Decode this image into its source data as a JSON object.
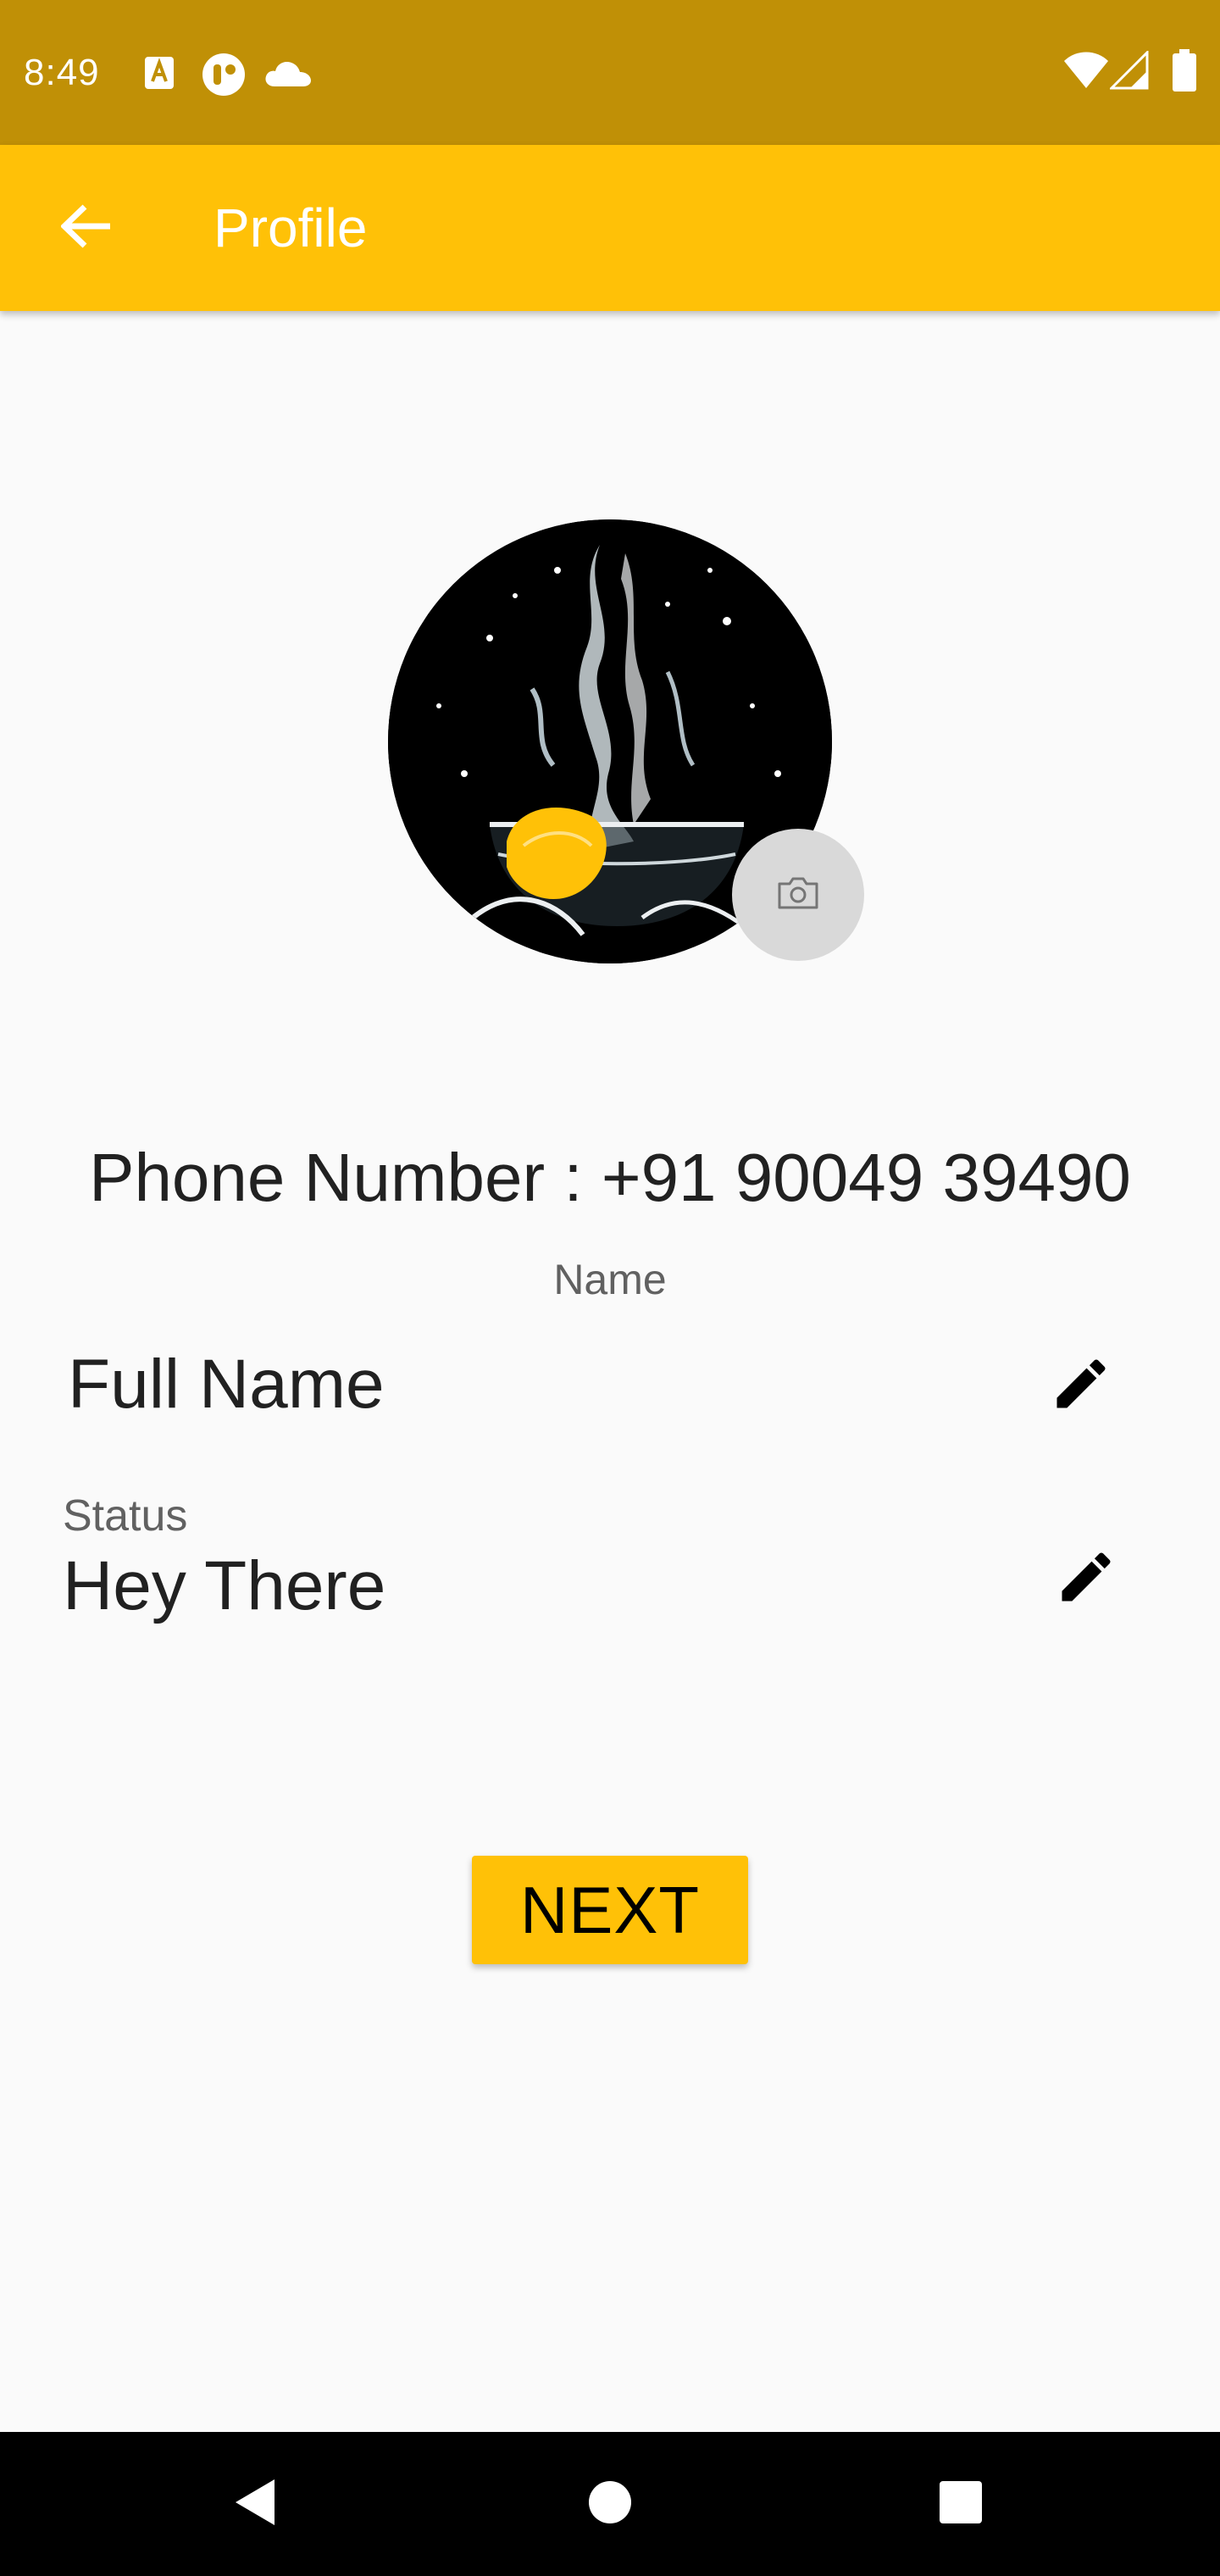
{
  "status_bar": {
    "time": "8:49",
    "icons": [
      "keyboard-a-icon",
      "app-notification-icon",
      "cloud-icon",
      "wifi-icon",
      "cell-signal-icon",
      "battery-icon"
    ]
  },
  "app_bar": {
    "title": "Profile",
    "back_icon": "arrow-back-icon"
  },
  "profile": {
    "phone_number": "Phone Number : +91 90049 39490",
    "name_label": "Name",
    "full_name": "Full Name",
    "status_label": "Status",
    "status_value": "Hey There"
  },
  "actions": {
    "next_label": "NEXT"
  },
  "colors": {
    "status_bar": "#c09006",
    "app_bar": "#ffc107",
    "background": "#fafafa",
    "camera_button": "#d9d9d9",
    "nav_bar": "#000000"
  }
}
